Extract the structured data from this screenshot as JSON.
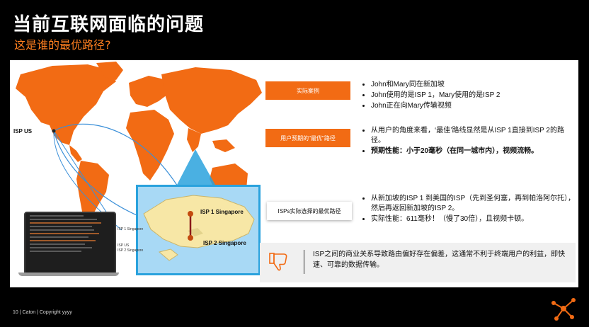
{
  "header": {
    "title": "当前互联网面临的问题",
    "subtitle": "这是谁的最优路径?"
  },
  "map": {
    "isp_us_label": "ISP US",
    "isp1_label": "ISP 1 Singapore",
    "isp2_label": "ISP 2 Singapore",
    "land_color": "#f26b14",
    "route_color": "#3a8fd8"
  },
  "laptop": {
    "tags": [
      "ISP 1 Singapore",
      "ISP US",
      "ISP 2 Singapore"
    ]
  },
  "rows": [
    {
      "label": "实际案例",
      "style": "orange",
      "bullets": [
        {
          "text": "John和Mary同在新加坡",
          "bold": false
        },
        {
          "text": "John使用的是ISP 1，Mary使用的是ISP 2",
          "bold": false
        },
        {
          "text": "John正在向Mary传输视频",
          "bold": false
        }
      ]
    },
    {
      "label": "用户预期的\"最优\"路径",
      "style": "orange",
      "bullets": [
        {
          "text": "从用户的角度来看，‘最佳’路线显然是从ISP 1直接到ISP 2的路径。",
          "bold": false
        },
        {
          "text": "预期性能：小于20毫秒（在同一城市内），视频流畅。",
          "bold": true
        }
      ]
    },
    {
      "label": "ISPs实际选择的最优路径",
      "style": "white",
      "bullets": [
        {
          "text": "从新加坡的ISP 1 到美国的ISP（先到圣何塞，再到帕洛阿尔托），然后再返回新加坡的ISP 2。",
          "bold": false
        },
        {
          "text": "实际性能：611毫秒！（慢了30倍），且视频卡顿。",
          "bold": false
        }
      ]
    }
  ],
  "summary": {
    "icon": "thumbs-down-icon",
    "text": "ISP之间的商业关系导致路由偏好存在偏差，这通常不利于终端用户的利益，即快速、可靠的数据传输。"
  },
  "footer": {
    "text": "10 | Caton | Copyright yyyy"
  },
  "colors": {
    "accent": "#f26b14",
    "subtitle": "#ff7f1f",
    "highlight_border": "#2aa2dd"
  }
}
